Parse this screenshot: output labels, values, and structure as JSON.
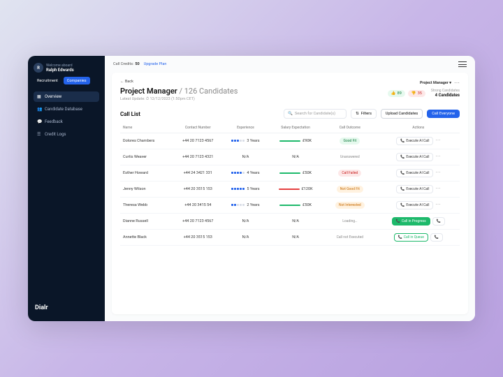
{
  "sidebar": {
    "welcome": "Welcome aboard",
    "username": "Ralph Edwards",
    "avatar_initial": "R",
    "tabs": [
      {
        "label": "Recruitment",
        "active": false
      },
      {
        "label": "Companies",
        "active": true
      }
    ],
    "nav": [
      {
        "label": "Overview",
        "icon": "grid",
        "active": true
      },
      {
        "label": "Candidate Database",
        "icon": "users",
        "active": false
      },
      {
        "label": "Feedback",
        "icon": "chat",
        "active": false
      },
      {
        "label": "Credit Logs",
        "icon": "list",
        "active": false
      }
    ],
    "brand": "Dialr"
  },
  "topbar": {
    "credits_label": "Call Credits:",
    "credits_value": "50",
    "upgrade": "Upgrade Plan"
  },
  "header": {
    "back": "← Back",
    "title_role": "Project Manager",
    "title_sep": " / ",
    "title_count": "126 Candidates",
    "updated_label": "Latest Update: ",
    "updated_value": "12/12/2023 (1:50pm CET)",
    "pm_pill": "Project Manager ▾",
    "thumbs_up": "89",
    "thumbs_down": "35",
    "strong_label": "Strong Candidates",
    "strong_value": "4 Candidates"
  },
  "listbar": {
    "title": "Call List",
    "search_placeholder": "Search for Candidate(s)",
    "filters": "Filters",
    "upload": "Upload Candidates",
    "call_all": "Call Everyone"
  },
  "columns": [
    "Name",
    "Contact Number",
    "Experience",
    "Salary Expectation",
    "Call Outcome",
    "Actions"
  ],
  "rows": [
    {
      "name": "Dolores Chambers",
      "contact": "+44 20 7123 4567",
      "exp_dots": 3,
      "exp_label": "3 Years",
      "salary": "£90K",
      "salary_color": "#1db96b",
      "outcome": "Good Fit",
      "outcome_class": "o-good",
      "action": "Execute AI Call",
      "action_class": "action-btn",
      "extra": "more"
    },
    {
      "name": "Curtis Weaver",
      "contact": "+44 20 7123 4321",
      "exp_dots": 0,
      "exp_label": "N/A",
      "salary": "N/A",
      "salary_color": "",
      "outcome": "Unanswered",
      "outcome_class": "o-unanswered",
      "action": "Execute AI Call",
      "action_class": "action-btn",
      "extra": "more"
    },
    {
      "name": "Esther Howard",
      "contact": "+44 24 3421 331",
      "exp_dots": 4,
      "exp_label": "4 Years",
      "salary": "£50K",
      "salary_color": "#1db96b",
      "outcome": "Call Failed",
      "outcome_class": "o-failed",
      "action": "Execute AI Call",
      "action_class": "action-btn",
      "extra": "more"
    },
    {
      "name": "Jenny Wilson",
      "contact": "+44 20 3515 153",
      "exp_dots": 5,
      "exp_label": "5 Years",
      "salary": "£120K",
      "salary_color": "#e53e3e",
      "outcome": "Not Good Fit",
      "outcome_class": "o-notgood",
      "action": "Execute AI Call",
      "action_class": "action-btn",
      "extra": "more"
    },
    {
      "name": "Theresa Webb",
      "contact": "+44 20 3415 54",
      "exp_dots": 2,
      "exp_label": "2 Years",
      "salary": "£50K",
      "salary_color": "#1db96b",
      "outcome": "Not Interested",
      "outcome_class": "o-notint",
      "action": "Execute AI Call",
      "action_class": "action-btn",
      "extra": "more"
    },
    {
      "name": "Dianne Russell",
      "contact": "+44 20 7123 4567",
      "exp_dots": 0,
      "exp_label": "N/A",
      "salary": "N/A",
      "salary_color": "",
      "outcome": "Loading…",
      "outcome_class": "o-loading",
      "action": "Call in Progress",
      "action_class": "action-btn action-green",
      "extra": "phone"
    },
    {
      "name": "Annette Black",
      "contact": "+44 20 3515 153",
      "exp_dots": 0,
      "exp_label": "N/A",
      "salary": "N/A",
      "salary_color": "",
      "outcome": "Call not Executed",
      "outcome_class": "o-notexec",
      "action": "Call in Queue",
      "action_class": "action-btn action-queue",
      "extra": "phone"
    }
  ]
}
